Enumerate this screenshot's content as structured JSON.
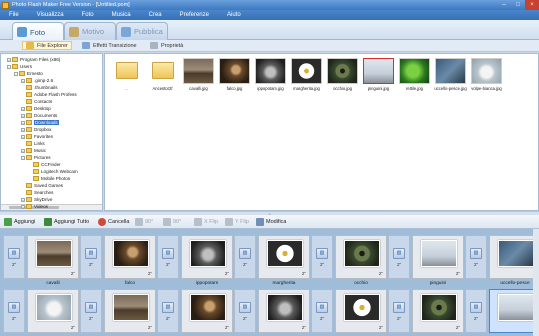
{
  "window": {
    "title": "Photo Flash Maker Free Version - [Untitled.pom]"
  },
  "menu": [
    "File",
    "Visualizza",
    "Foto",
    "Musica",
    "Crea",
    "Preferenze",
    "Aiuto"
  ],
  "tabs": [
    {
      "label": "Foto",
      "active": true,
      "color": "#5b9bd5"
    },
    {
      "label": "Motivo",
      "active": false,
      "color": "#c4a96a"
    },
    {
      "label": "Pubblica",
      "active": false,
      "color": "#7aa7d8"
    }
  ],
  "subbar": {
    "file_explorer": "File Explorer",
    "transition_effects": "Effetti Transizione",
    "properties": "Proprietà"
  },
  "tree": {
    "items": [
      {
        "label": "Program Files (x86)",
        "indent": 0,
        "exp": "+"
      },
      {
        "label": "Users",
        "indent": 0,
        "exp": "-"
      },
      {
        "label": "Ernesto",
        "indent": 1,
        "exp": "-"
      },
      {
        "label": ".gimp-2.6",
        "indent": 2,
        "exp": "+"
      },
      {
        "label": ".thumbnails",
        "indent": 2,
        "exp": ""
      },
      {
        "label": "Adobe Flash Profess",
        "indent": 2,
        "exp": ""
      },
      {
        "label": "Contacts",
        "indent": 2,
        "exp": ""
      },
      {
        "label": "Desktop",
        "indent": 2,
        "exp": "+"
      },
      {
        "label": "Documents",
        "indent": 2,
        "exp": "+"
      },
      {
        "label": "Downloads",
        "indent": 2,
        "exp": "+",
        "selected": true
      },
      {
        "label": "Dropbox",
        "indent": 2,
        "exp": "+"
      },
      {
        "label": "Favorites",
        "indent": 2,
        "exp": "+"
      },
      {
        "label": "Links",
        "indent": 2,
        "exp": ""
      },
      {
        "label": "Music",
        "indent": 2,
        "exp": "+"
      },
      {
        "label": "Pictures",
        "indent": 2,
        "exp": "-"
      },
      {
        "label": "CCFinder",
        "indent": 3,
        "exp": ""
      },
      {
        "label": "Logitech Webcam",
        "indent": 3,
        "exp": ""
      },
      {
        "label": "Mobile Photos",
        "indent": 3,
        "exp": ""
      },
      {
        "label": "Saved Games",
        "indent": 2,
        "exp": ""
      },
      {
        "label": "Searches",
        "indent": 2,
        "exp": ""
      },
      {
        "label": "SkyDrive",
        "indent": 2,
        "exp": "+"
      },
      {
        "label": "Videos",
        "indent": 2,
        "exp": "+"
      }
    ]
  },
  "files": [
    {
      "name": "..",
      "kind": "folder"
    },
    {
      "name": "Ancestor2f",
      "kind": "folder"
    },
    {
      "name": "cavalli.jpg",
      "kind": "image",
      "thumb": "horse"
    },
    {
      "name": "falco.jpg",
      "kind": "image",
      "thumb": "falcon"
    },
    {
      "name": "ippopotam.jpg",
      "kind": "image",
      "thumb": "hippo"
    },
    {
      "name": "margherita.jpg",
      "kind": "image",
      "thumb": "daisy"
    },
    {
      "name": "occhio.jpg",
      "kind": "image",
      "thumb": "eye"
    },
    {
      "name": "pinguini.jpg",
      "kind": "image",
      "thumb": "penguin",
      "selected": true
    },
    {
      "name": "rettile.jpg",
      "kind": "image",
      "thumb": "reptile"
    },
    {
      "name": "uccello-pesce.jpg",
      "kind": "image",
      "thumb": "fishbird"
    },
    {
      "name": "volpe-bianca.jpg",
      "kind": "image",
      "thumb": "fox"
    }
  ],
  "toolbar": {
    "add": "Aggiungi",
    "add_all": "Aggiungi Tutto",
    "delete": "Cancella",
    "rot_left": "90°",
    "rot_right": "90°",
    "xflip": "X Flip",
    "yflip": "Y Flip",
    "edit": "Modifica"
  },
  "timeline": {
    "row1": [
      {
        "caption": "cavalli",
        "dur": "2\"",
        "trans_dur": "2\"",
        "thumb": "horse"
      },
      {
        "caption": "falco",
        "dur": "2\"",
        "trans_dur": "2\"",
        "thumb": "falcon"
      },
      {
        "caption": "ippopotam",
        "dur": "2\"",
        "trans_dur": "2\"",
        "thumb": "hippo"
      },
      {
        "caption": "margherita",
        "dur": "2\"",
        "trans_dur": "2\"",
        "thumb": "daisy"
      },
      {
        "caption": "occhio",
        "dur": "2\"",
        "trans_dur": "2\"",
        "thumb": "eye"
      },
      {
        "caption": "pinguini",
        "dur": "2\"",
        "trans_dur": "2\"",
        "thumb": "penguin"
      },
      {
        "caption": "uccello-pesce",
        "dur": "2\"",
        "trans_dur": "2\"",
        "thumb": "fishbird"
      }
    ],
    "row2": [
      {
        "dur": "2\"",
        "trans_dur": "2\"",
        "thumb": "fox"
      },
      {
        "dur": "2\"",
        "trans_dur": "2\"",
        "thumb": "horse"
      },
      {
        "dur": "2\"",
        "trans_dur": "2\"",
        "thumb": "falcon"
      },
      {
        "dur": "2\"",
        "trans_dur": "2\"",
        "thumb": "hippo"
      },
      {
        "dur": "2\"",
        "trans_dur": "2\"",
        "thumb": "daisy"
      },
      {
        "dur": "2\"",
        "trans_dur": "2\"",
        "thumb": "eye"
      },
      {
        "dur": "2\"",
        "trans_dur": "2\"",
        "thumb": "penguin",
        "selected": true
      }
    ]
  }
}
